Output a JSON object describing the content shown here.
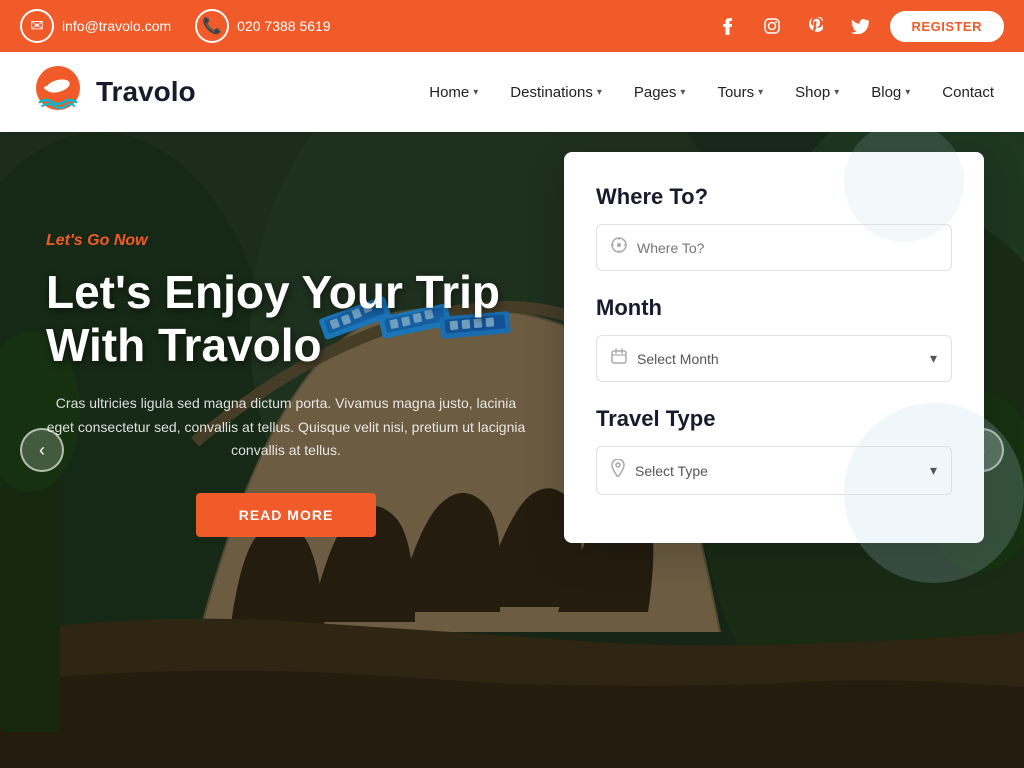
{
  "topbar": {
    "email": "info@travolo.com",
    "phone": "020 7388 5619",
    "register_label": "REGISTER"
  },
  "social": {
    "facebook": "f",
    "instagram": "ig",
    "pinterest": "p",
    "twitter": "t"
  },
  "nav": {
    "logo_text": "Travolo",
    "items": [
      {
        "label": "Home",
        "has_dropdown": true
      },
      {
        "label": "Destinations",
        "has_dropdown": true
      },
      {
        "label": "Pages",
        "has_dropdown": true
      },
      {
        "label": "Tours",
        "has_dropdown": true
      },
      {
        "label": "Shop",
        "has_dropdown": true
      },
      {
        "label": "Blog",
        "has_dropdown": true
      },
      {
        "label": "Contact",
        "has_dropdown": false
      }
    ]
  },
  "hero": {
    "tagline": "Let's Go Now",
    "title": "Let's Enjoy Your Trip With Travolo",
    "description": "Cras ultricies ligula sed magna dictum porta. Vivamus magna justo, lacinia eget consectetur sed, convallis at tellus. Quisque velit nisi, pretium ut lacignia convallis at tellus.",
    "cta_label": "READ MORE",
    "prev_label": "‹",
    "next_label": "›"
  },
  "search_panel": {
    "where_to_label": "Where To?",
    "where_to_placeholder": "Where To?",
    "month_label": "Month",
    "month_placeholder": "Select Month",
    "travel_type_label": "Travel Type",
    "travel_type_placeholder": "Select Type"
  }
}
